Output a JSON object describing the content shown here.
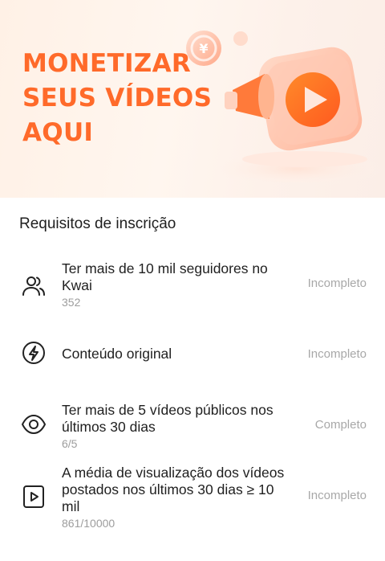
{
  "banner": {
    "title_line1": "MONETIZAR",
    "title_line2": "SEUS VÍDEOS",
    "title_line3": "AQUI",
    "accent_color": "#ff6a2a",
    "illustration_icon": "video-play-icon"
  },
  "requirements_section": {
    "title": "Requisitos de inscrição",
    "items": [
      {
        "icon": "users-icon",
        "title": "Ter mais de 10 mil seguidores no Kwai",
        "progress": "352",
        "status": "Incompleto"
      },
      {
        "icon": "lightning-icon",
        "title": "Conteúdo original",
        "progress": "",
        "status": "Incompleto"
      },
      {
        "icon": "eye-icon",
        "title": "Ter mais de 5 vídeos públicos nos últimos 30 dias",
        "progress": "6/5",
        "status": "Completo"
      },
      {
        "icon": "play-square-icon",
        "title": "A média de visualização dos vídeos postados nos últimos 30 dias ≥ 10 mil",
        "progress": "861/10000",
        "status": "Incompleto"
      }
    ]
  }
}
